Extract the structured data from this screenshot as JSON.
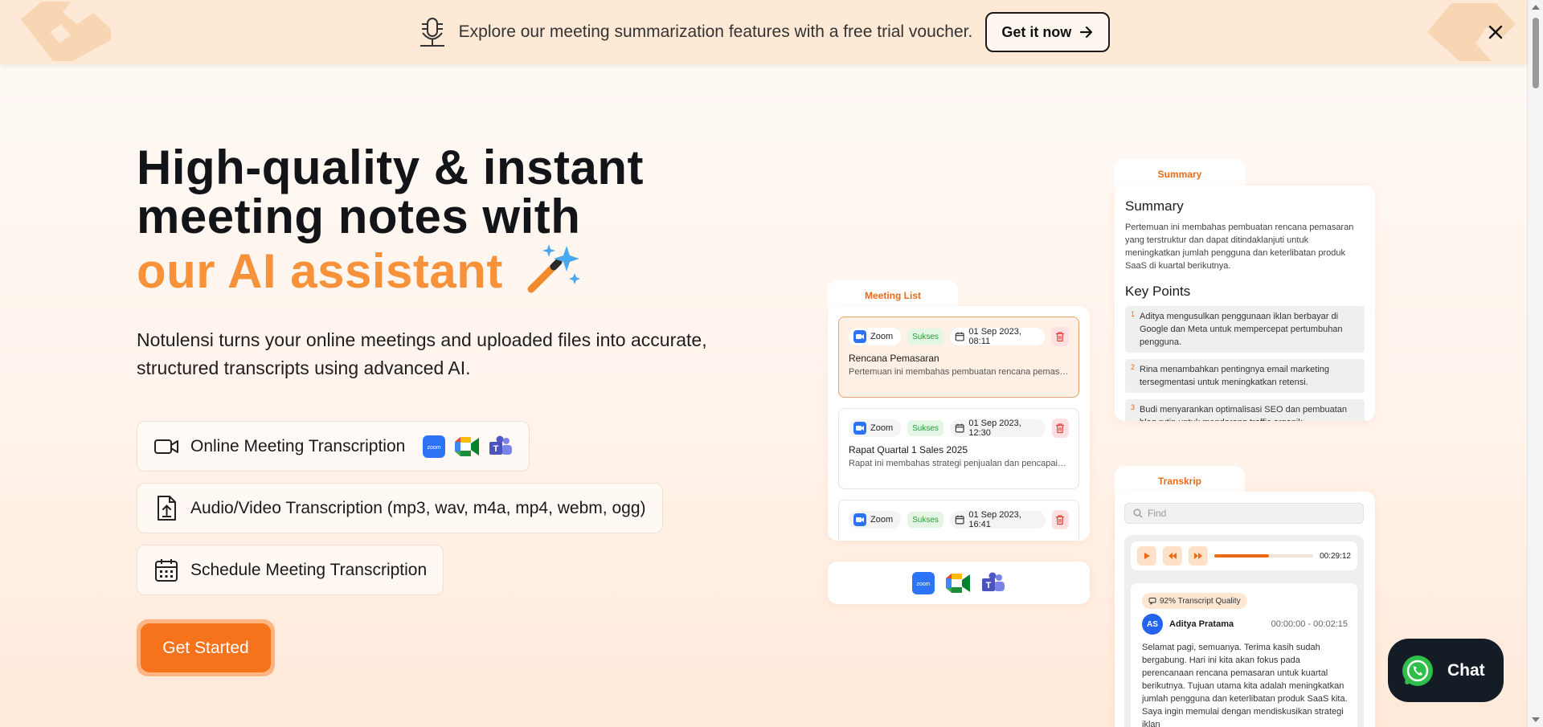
{
  "banner": {
    "text": "Explore our meeting summarization features with a free trial voucher.",
    "cta_label": "Get it now",
    "icon": "microphone-icon",
    "close_icon": "close-icon"
  },
  "hero": {
    "title_line1": "High-quality & instant",
    "title_line2": "meeting notes with",
    "title_accent": "our AI assistant",
    "description": "Notulensi turns your online meetings and uploaded files into accurate, structured transcripts using advanced AI.",
    "features": [
      {
        "label": "Online Meeting Transcription",
        "icon": "video-camera-icon"
      },
      {
        "label": "Audio/Video Transcription (mp3, wav, m4a, mp4, webm, ogg)",
        "icon": "upload-file-icon"
      },
      {
        "label": "Schedule Meeting Transcription",
        "icon": "calendar-icon"
      }
    ],
    "cta_label": "Get Started"
  },
  "meeting_list": {
    "tab_label": "Meeting List",
    "items": [
      {
        "platform": "Zoom",
        "status": "Sukses",
        "date": "01 Sep 2023, 08:11",
        "title": "Rencana Pemasaran",
        "summary": "Pertemuan ini membahas pembuatan rencana pemasaran yang terstruktur"
      },
      {
        "platform": "Zoom",
        "status": "Sukses",
        "date": "01 Sep 2023, 12:30",
        "title": "Rapat Quartal 1 Sales 2025",
        "summary": "Rapat ini membahas strategi penjualan dan pencapaian target"
      },
      {
        "platform": "Zoom",
        "status": "Sukses",
        "date": "01 Sep 2023, 16:41",
        "title": "",
        "summary": ""
      }
    ]
  },
  "summary": {
    "tab_label": "Summary",
    "heading": "Summary",
    "text": "Pertemuan ini membahas pembuatan rencana pemasaran yang terstruktur dan dapat ditindaklanjuti untuk meningkatkan jumlah pengguna dan keterlibatan produk SaaS di kuartal berikutnya.",
    "key_points_heading": "Key Points",
    "key_points": [
      {
        "n": "1",
        "text": "Aditya mengusulkan penggunaan iklan berbayar di Google dan Meta untuk mempercepat pertumbuhan pengguna."
      },
      {
        "n": "2",
        "text": "Rina menambahkan pentingnya email marketing tersegmentasi untuk meningkatkan retensi."
      },
      {
        "n": "3",
        "text": "Budi menyarankan optimalisasi SEO dan pembuatan blog rutin untuk mendorong traffic organik."
      }
    ]
  },
  "transcript": {
    "tab_label": "Transkrip",
    "search_placeholder": "Find",
    "duration": "00:29:12",
    "progress": 0.55,
    "quality_badge": "92% Transcript Quality",
    "speaker_initials": "AS",
    "speaker_name": "Aditya Pratama",
    "time_range": "00:00:00 - 00:02:15",
    "text": "Selamat pagi, semuanya. Terima kasih sudah bergabung. Hari ini kita akan fokus pada perencanaan rencana pemasaran untuk kuartal berikutnya. Tujuan utama kita adalah meningkatkan jumlah pengguna dan keterlibatan produk SaaS kita. Saya ingin memulai dengan mendiskusikan strategi iklan"
  },
  "platforms": [
    "zoom-icon",
    "google-meet-icon",
    "microsoft-teams-icon"
  ],
  "chat": {
    "label": "Chat",
    "icon": "whatsapp-icon"
  },
  "colors": {
    "accent": "#f7923a",
    "cta": "#f5731b",
    "banner_bg": "#fde9d6",
    "tab_accent": "#ea6a17"
  }
}
